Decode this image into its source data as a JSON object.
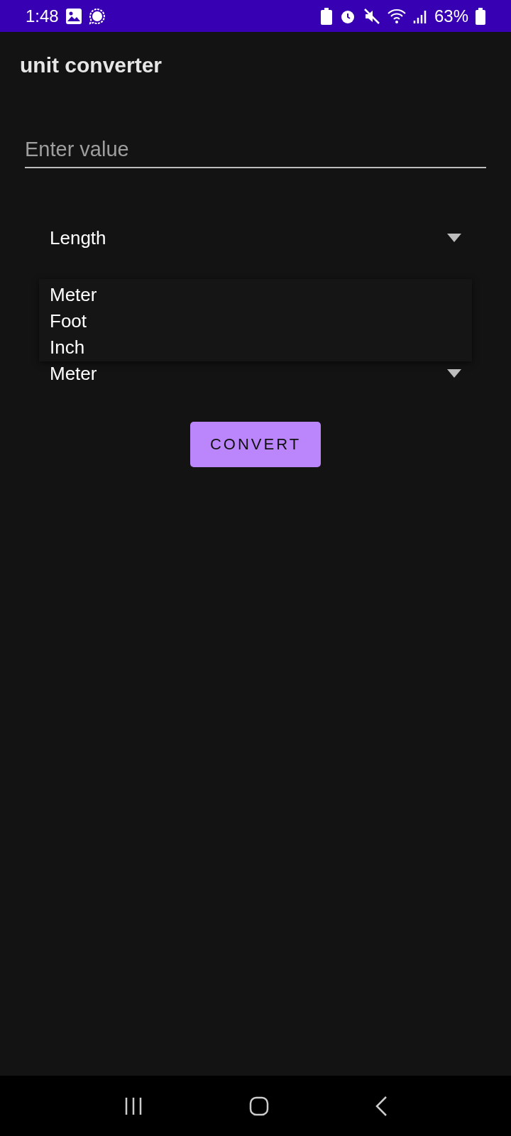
{
  "status_bar": {
    "time": "1:48",
    "battery": "63%"
  },
  "app_bar": {
    "title": "unit converter"
  },
  "value_field": {
    "placeholder": "Enter value"
  },
  "category_spinner": {
    "value": "Length"
  },
  "unit_spinner": {
    "value": "Meter"
  },
  "unit_menu": {
    "items": [
      {
        "label": "Meter"
      },
      {
        "label": "Foot"
      },
      {
        "label": "Inch"
      }
    ]
  },
  "convert_button": {
    "label": "CONVERT"
  }
}
